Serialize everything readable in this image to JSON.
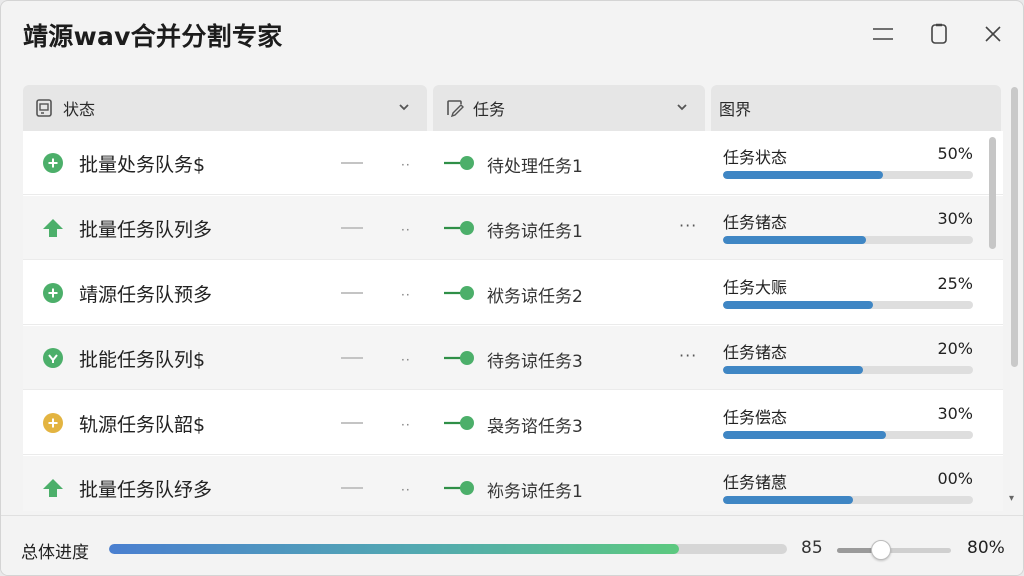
{
  "window": {
    "title": "靖源wav合并分割专家",
    "controls": [
      "minimize-icon",
      "restore-icon",
      "close-icon"
    ]
  },
  "header": {
    "columns": [
      {
        "label": "状态",
        "icon": "status-icon",
        "has_dropdown": true
      },
      {
        "label": "任务",
        "icon": "task-icon",
        "has_dropdown": true
      },
      {
        "label": "图界",
        "icon": "",
        "has_dropdown": false
      }
    ]
  },
  "colors": {
    "accent_blue": "#3f86c4",
    "green": "#4caf6a",
    "yellow": "#e3b441"
  },
  "rows": [
    {
      "icon": "plus-circle-icon",
      "icon_color": "#4caf6a",
      "name": "批量处务队务$",
      "dash": "—",
      "dots": "··",
      "task": "待处理任务1",
      "more": "",
      "status_label": "任务状态",
      "percent": "50%",
      "progress": 0.64
    },
    {
      "icon": "arrow-up-icon",
      "icon_color": "#4caf6a",
      "name": "批量任务队列多",
      "dash": "—",
      "dots": "··",
      "task": "待务谅任务1",
      "more": "···",
      "status_label": "任务锗态",
      "percent": "30%",
      "progress": 0.57
    },
    {
      "icon": "plus-circle-icon",
      "icon_color": "#4caf6a",
      "name": "靖源任务队预多",
      "dash": "—",
      "dots": "··",
      "task": "袱务谅任务2",
      "more": "",
      "status_label": "任务大赈",
      "percent": "25%",
      "progress": 0.6
    },
    {
      "icon": "check-circle-icon",
      "icon_color": "#4caf6a",
      "name": "批能任务队列$",
      "dash": "—",
      "dots": "··",
      "task": "待务谅任务3",
      "more": "···",
      "status_label": "任务锗态",
      "percent": "20%",
      "progress": 0.56
    },
    {
      "icon": "plus-circle-icon",
      "icon_color": "#e3b441",
      "name": "轨源任务队韶$",
      "dash": "—",
      "dots": "··",
      "task": "袅务谘任务3",
      "more": "",
      "status_label": "任务偿态",
      "percent": "30%",
      "progress": 0.65
    },
    {
      "icon": "arrow-up-icon",
      "icon_color": "#4caf6a",
      "name": "批量任务队纾多",
      "dash": "—",
      "dots": "··",
      "task": "袮务谅任务1",
      "more": "",
      "status_label": "任务锗蒽",
      "percent": "00%",
      "progress": 0.52
    }
  ],
  "footer": {
    "label": "总体进度",
    "overall_progress": 0.84,
    "number": "85",
    "slider_value": 0.38,
    "percent": "80%"
  }
}
